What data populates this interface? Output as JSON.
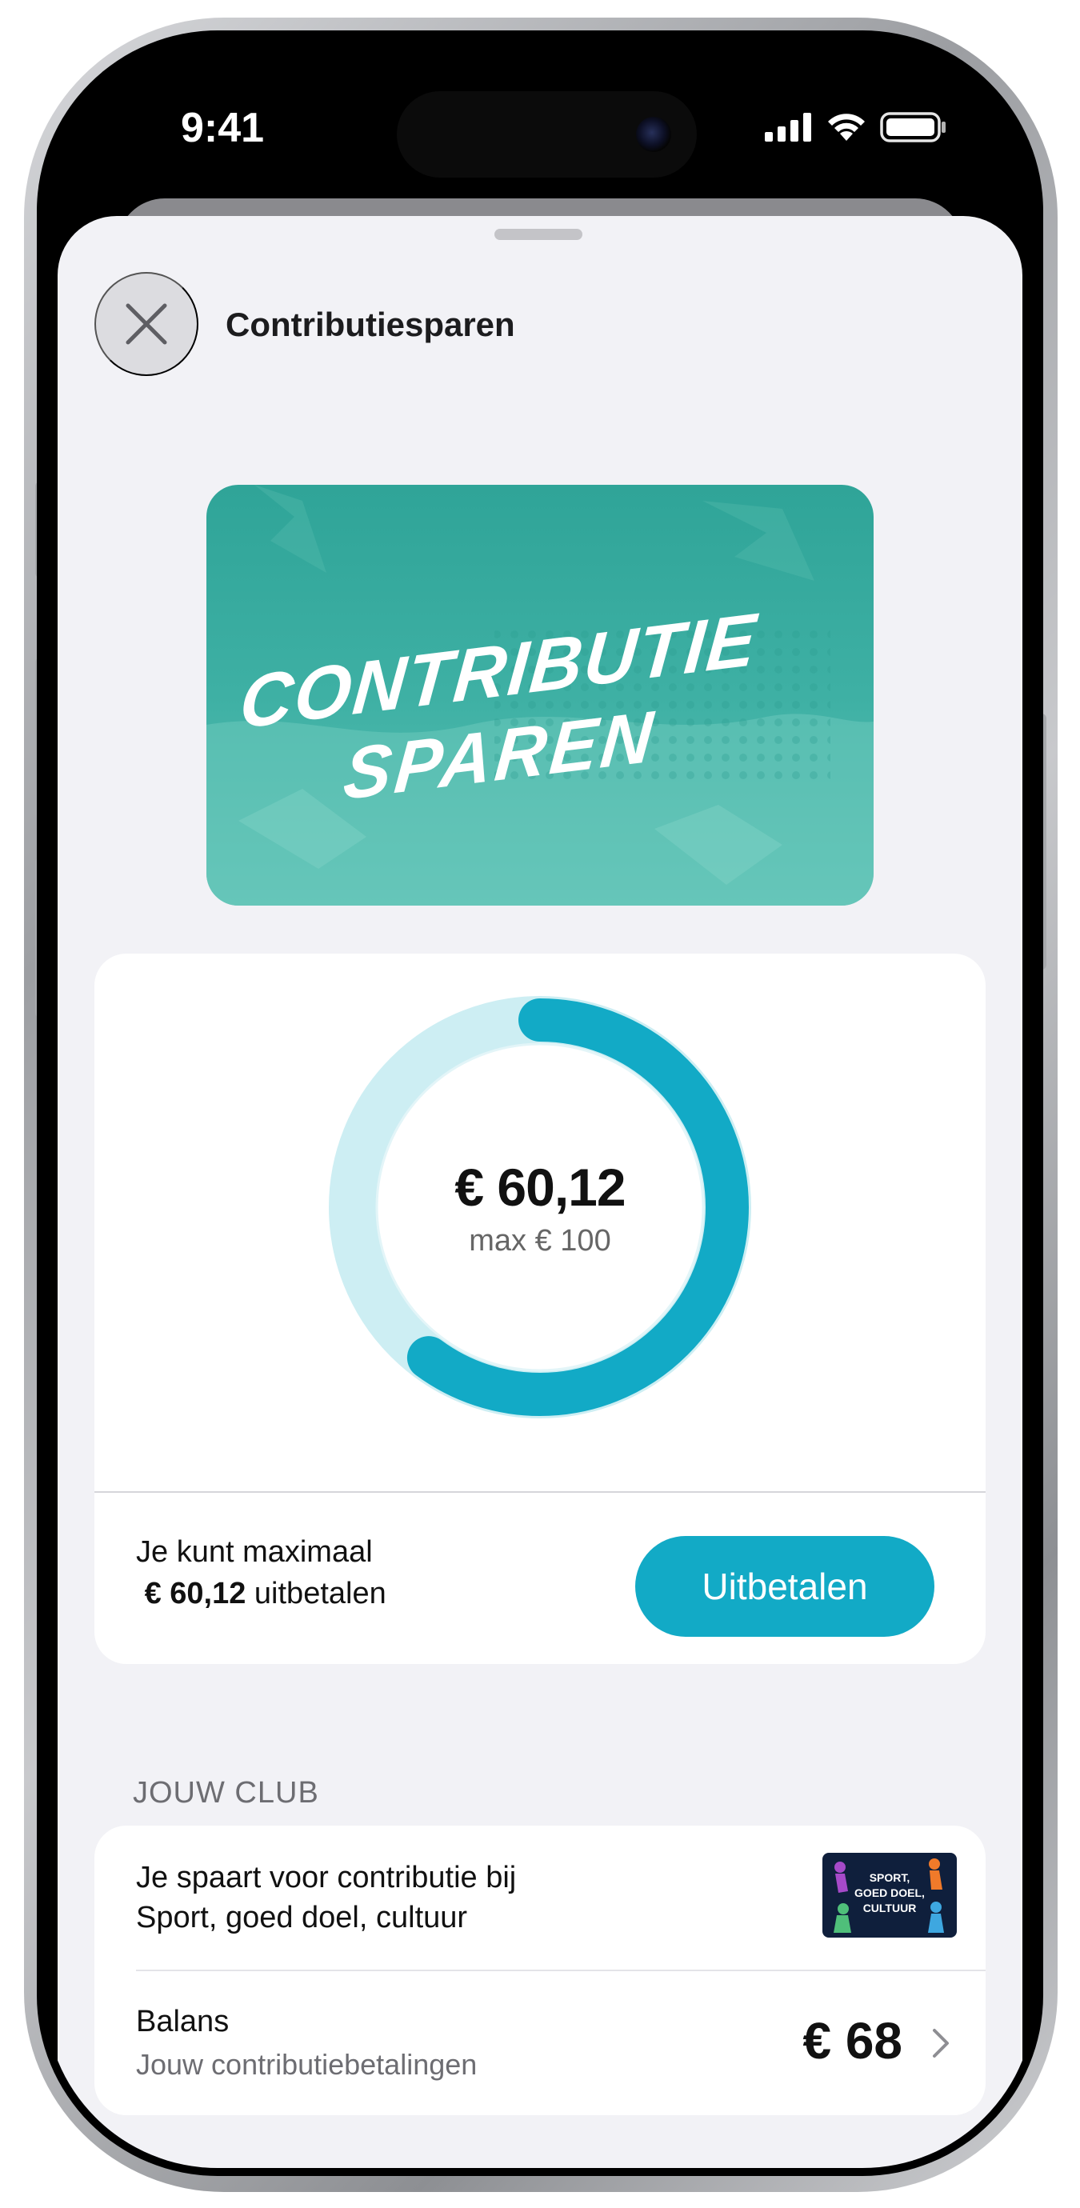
{
  "status_bar": {
    "time": "9:41",
    "icons": [
      "cellular-signal-icon",
      "wifi-icon",
      "battery-icon"
    ]
  },
  "header": {
    "close_icon": "close-icon",
    "title": "Contributiesparen"
  },
  "hero": {
    "line1": "CONTRIBUTIE",
    "line2": "SPAREN",
    "colors": {
      "background": "#3eb0a4",
      "text": "#ffffff"
    }
  },
  "progress": {
    "amount": "€ 60,12",
    "max_label": "max € 100",
    "fraction": 0.6012,
    "colors": {
      "track": "#cdeef3",
      "fill": "#12aac6"
    }
  },
  "payout": {
    "line1": "Je kunt maximaal",
    "amount": "€ 60,12",
    "suffix": "uitbetalen",
    "button_label": "Uitbetalen"
  },
  "club_section": {
    "label": "JOUW CLUB",
    "club_line1": "Je spaart voor contributie bij",
    "club_line2": "Sport, goed doel, cultuur",
    "logo_line1": "SPORT,",
    "logo_line2": "GOED DOEL,",
    "logo_line3": "CULTUUR",
    "balance_title": "Balans",
    "balance_sub": "Jouw contributiebetalingen",
    "balance_amount": "€ 68"
  },
  "colors": {
    "accent": "#12aac6",
    "sheet_background": "#f2f2f6"
  }
}
